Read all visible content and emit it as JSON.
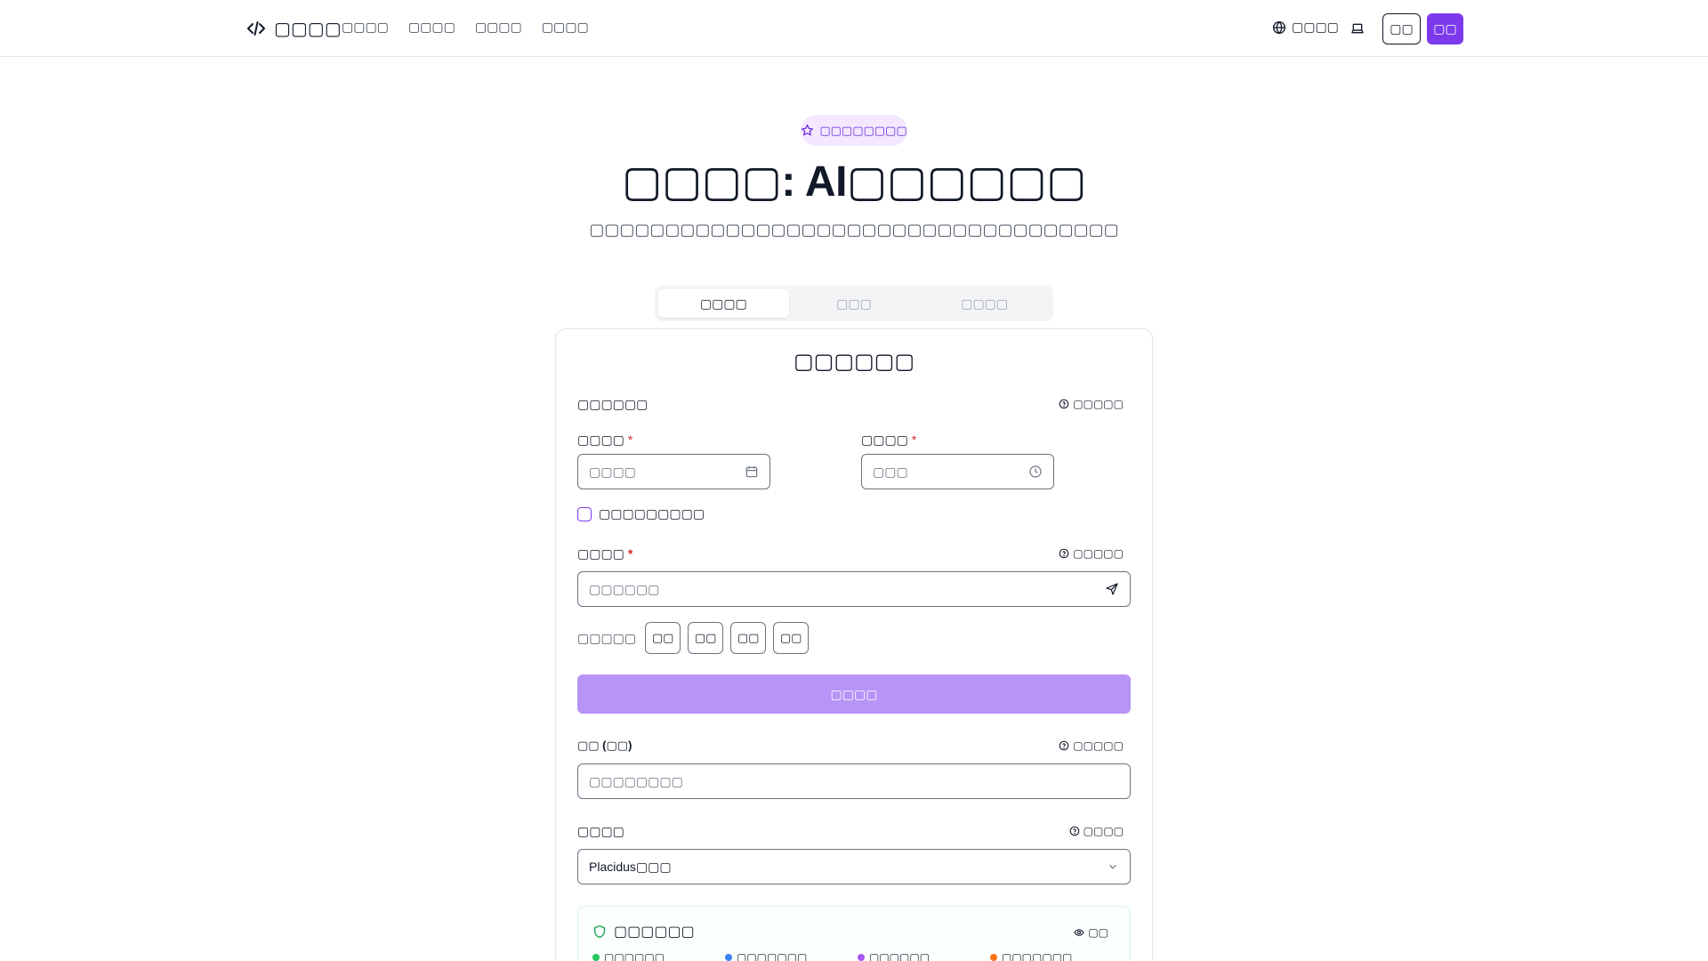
{
  "header": {
    "brand": "▢▢▢▢",
    "nav": [
      "▢▢▢▢",
      "▢▢▢▢",
      "▢▢▢▢",
      "▢▢▢▢"
    ],
    "language_label": "▢▢▢▢",
    "login_label": "▢▢",
    "signup_label": "▢▢"
  },
  "hero": {
    "badge": "▢▢▢▢▢▢▢▢",
    "title": "▢▢▢▢: AI▢▢▢▢▢▢",
    "subtitle": "▢▢▢▢▢▢▢▢▢▢▢▢▢▢▢▢▢▢▢▢▢▢▢▢▢▢▢▢▢▢▢▢▢▢▢"
  },
  "tabs": [
    {
      "label": "▢▢▢▢",
      "active": true
    },
    {
      "label": "▢▢▢",
      "active": false
    },
    {
      "label": "▢▢▢▢",
      "active": false
    }
  ],
  "form": {
    "title": "▢▢▢▢▢▢",
    "birth_section_label": "▢▢▢▢▢▢",
    "birth_section_help": "▢▢▢▢▢",
    "date_label": "▢▢▢▢",
    "date_placeholder": "▢▢▢▢",
    "time_label": "▢▢▢▢",
    "time_placeholder": "▢▢▢",
    "required_mark": "*",
    "unknown_time_label": "▢▢▢▢▢▢▢▢▢",
    "place_label": "▢▢▢▢",
    "place_help": "▢▢▢▢▢",
    "place_placeholder": "▢▢▢▢▢▢",
    "quick_label": "▢▢▢▢▢",
    "quick_options": [
      "▢▢",
      "▢▢",
      "▢▢",
      "▢▢"
    ],
    "submit_label": "▢▢▢▢",
    "name_label": "▢▢ (▢▢)",
    "name_help": "▢▢▢▢▢",
    "name_placeholder": "▢▢▢▢▢▢▢▢",
    "house_label": "▢▢▢▢",
    "house_help": "▢▢▢▢",
    "house_value": "Placidus▢▢▢"
  },
  "privacy": {
    "title": "▢▢▢▢▢▢",
    "view_label": "▢▢",
    "items": [
      {
        "label": "▢▢▢▢▢▢",
        "color": "#22c55e"
      },
      {
        "label": "▢▢▢▢▢▢▢",
        "color": "#3b82f6"
      },
      {
        "label": "▢▢▢▢▢▢",
        "color": "#a855f7"
      },
      {
        "label": "▢▢▢▢▢▢▢",
        "color": "#f97316"
      }
    ]
  },
  "colors": {
    "accent": "#7c3aed",
    "accent_light": "#b794f6",
    "badge_bg": "#f3e8ff",
    "required": "#dc2626"
  },
  "icons": {
    "logo": "code-brackets-icon",
    "language": "globe-icon",
    "theme": "laptop-icon",
    "badge": "star-icon",
    "help": "question-circle-icon",
    "date": "calendar-icon",
    "time": "clock-icon",
    "place": "send-arrow-icon",
    "select": "chevron-down-icon",
    "privacy": "shield-icon",
    "view": "eye-icon"
  }
}
